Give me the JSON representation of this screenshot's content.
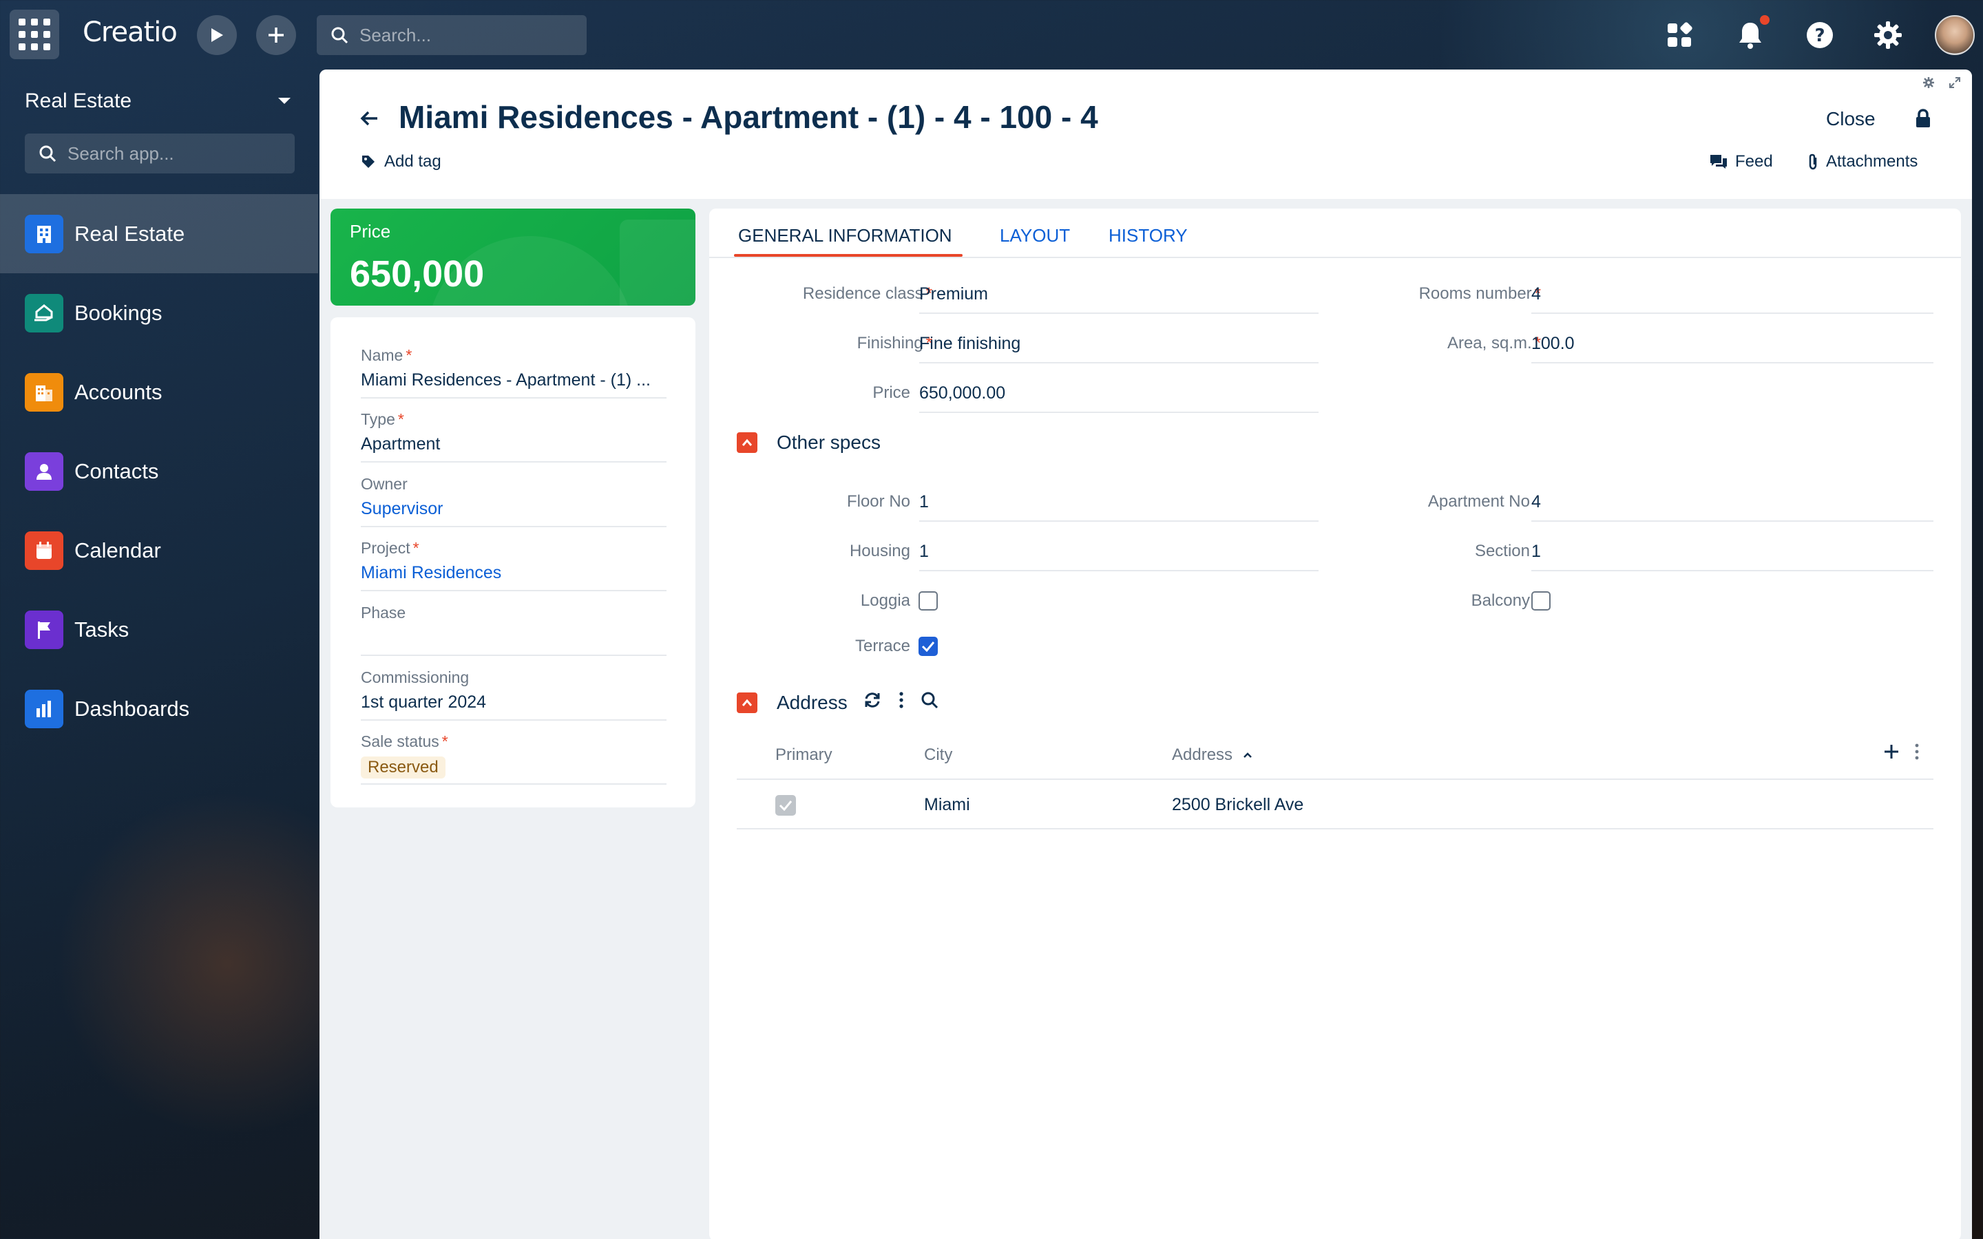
{
  "topbar": {
    "logo": "Creatio",
    "search_placeholder": "Search..."
  },
  "sidebar": {
    "workspace": "Real Estate",
    "search_placeholder": "Search app...",
    "items": [
      {
        "label": "Real Estate",
        "icon": "building-icon",
        "color": "#1e6fe0",
        "active": true
      },
      {
        "label": "Bookings",
        "icon": "home-hand-icon",
        "color": "#0f8a7a"
      },
      {
        "label": "Accounts",
        "icon": "office-icon",
        "color": "#f08c0c"
      },
      {
        "label": "Contacts",
        "icon": "person-icon",
        "color": "#7a3fdc"
      },
      {
        "label": "Calendar",
        "icon": "calendar-icon",
        "color": "#e8462a"
      },
      {
        "label": "Tasks",
        "icon": "flag-icon",
        "color": "#6b2fcf"
      },
      {
        "label": "Dashboards",
        "icon": "bar-chart-icon",
        "color": "#1e6fe0"
      }
    ]
  },
  "header": {
    "title": "Miami Residences - Apartment - (1) - 4 - 100 - 4",
    "add_tag": "Add tag",
    "close": "Close",
    "feed": "Feed",
    "attachments": "Attachments"
  },
  "price_card": {
    "label": "Price",
    "value": "650,000",
    "color": "#14ab48"
  },
  "info": {
    "name_label": "Name",
    "name_value": "Miami Residences - Apartment - (1) ...",
    "type_label": "Type",
    "type_value": "Apartment",
    "owner_label": "Owner",
    "owner_value": "Supervisor",
    "project_label": "Project",
    "project_value": "Miami Residences",
    "phase_label": "Phase",
    "phase_value": "",
    "commissioning_label": "Commissioning",
    "commissioning_value": "1st quarter 2024",
    "sale_status_label": "Sale status",
    "sale_status_value": "Reserved"
  },
  "tabs": [
    "GENERAL INFORMATION",
    "LAYOUT",
    "HISTORY"
  ],
  "general": {
    "residence_class_label": "Residence class",
    "residence_class_value": "Premium",
    "finishing_label": "Finishing",
    "finishing_value": "Fine finishing",
    "price_label": "Price",
    "price_value": "650,000.00",
    "rooms_label": "Rooms number",
    "rooms_value": "4",
    "area_label": "Area, sq.m.",
    "area_value": "100.0"
  },
  "other_specs": {
    "title": "Other specs",
    "floor_label": "Floor No",
    "floor_value": "1",
    "housing_label": "Housing",
    "housing_value": "1",
    "loggia_label": "Loggia",
    "loggia_checked": false,
    "terrace_label": "Terrace",
    "terrace_checked": true,
    "apartment_label": "Apartment No",
    "apartment_value": "4",
    "section_label": "Section",
    "section_value": "1",
    "balcony_label": "Balcony",
    "balcony_checked": false
  },
  "address": {
    "title": "Address",
    "columns": [
      "Primary",
      "City",
      "Address"
    ],
    "rows": [
      {
        "primary": true,
        "city": "Miami",
        "address": "2500 Brickell Ave"
      }
    ]
  }
}
